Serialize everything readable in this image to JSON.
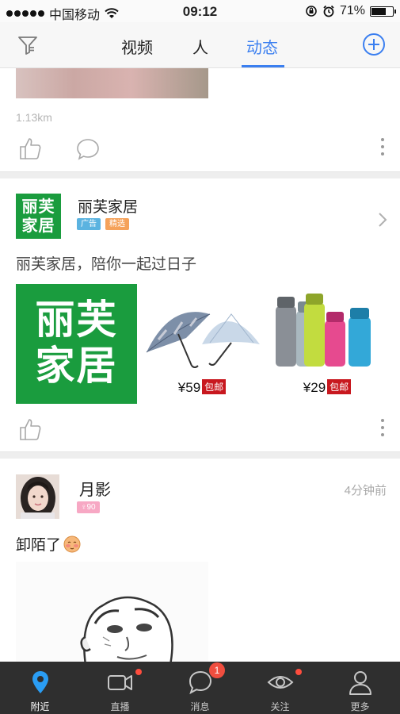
{
  "status_bar": {
    "carrier": "中国移动",
    "time": "09:12",
    "battery": "71%",
    "battery_fraction": 0.71,
    "icons": [
      "signal-dots",
      "wifi-icon",
      "rotation-lock-icon",
      "alarm-icon",
      "battery-icon"
    ]
  },
  "nav": {
    "tabs": [
      {
        "label": "视频"
      },
      {
        "label": "人"
      },
      {
        "label": "动态"
      }
    ],
    "active_tab": "动态",
    "accent_color": "#3b7ff0",
    "left_icon": "filter-icon",
    "right_icon": "add-circle-icon"
  },
  "feed": {
    "prev_post": {
      "distance": "1.13km"
    },
    "ad_post": {
      "name": "丽芙家居",
      "logo_text_line1": "丽芙",
      "logo_text_line2": "家居",
      "badge_ad": "广告",
      "badge_pick": "精选",
      "text": "丽芙家居，陪你一起过日子",
      "big_text_line1": "丽芙",
      "big_text_line2": "家居",
      "products": [
        {
          "price": "¥59",
          "tag": "包邮",
          "icon": "umbrella-product"
        },
        {
          "price": "¥29",
          "tag": "包邮",
          "icon": "water-bottle-product"
        }
      ]
    },
    "user_post": {
      "name": "月影",
      "level": "♀90",
      "time": "4分钟前",
      "text": "卸陌了"
    }
  },
  "tabbar": {
    "items": [
      {
        "label": "附近",
        "icon": "location-pin-icon"
      },
      {
        "label": "直播",
        "icon": "video-camera-icon"
      },
      {
        "label": "消息",
        "icon": "chat-bubble-icon",
        "badge": "1"
      },
      {
        "label": "关注",
        "icon": "eye-icon"
      },
      {
        "label": "更多",
        "icon": "person-icon"
      }
    ],
    "active": "附近"
  }
}
